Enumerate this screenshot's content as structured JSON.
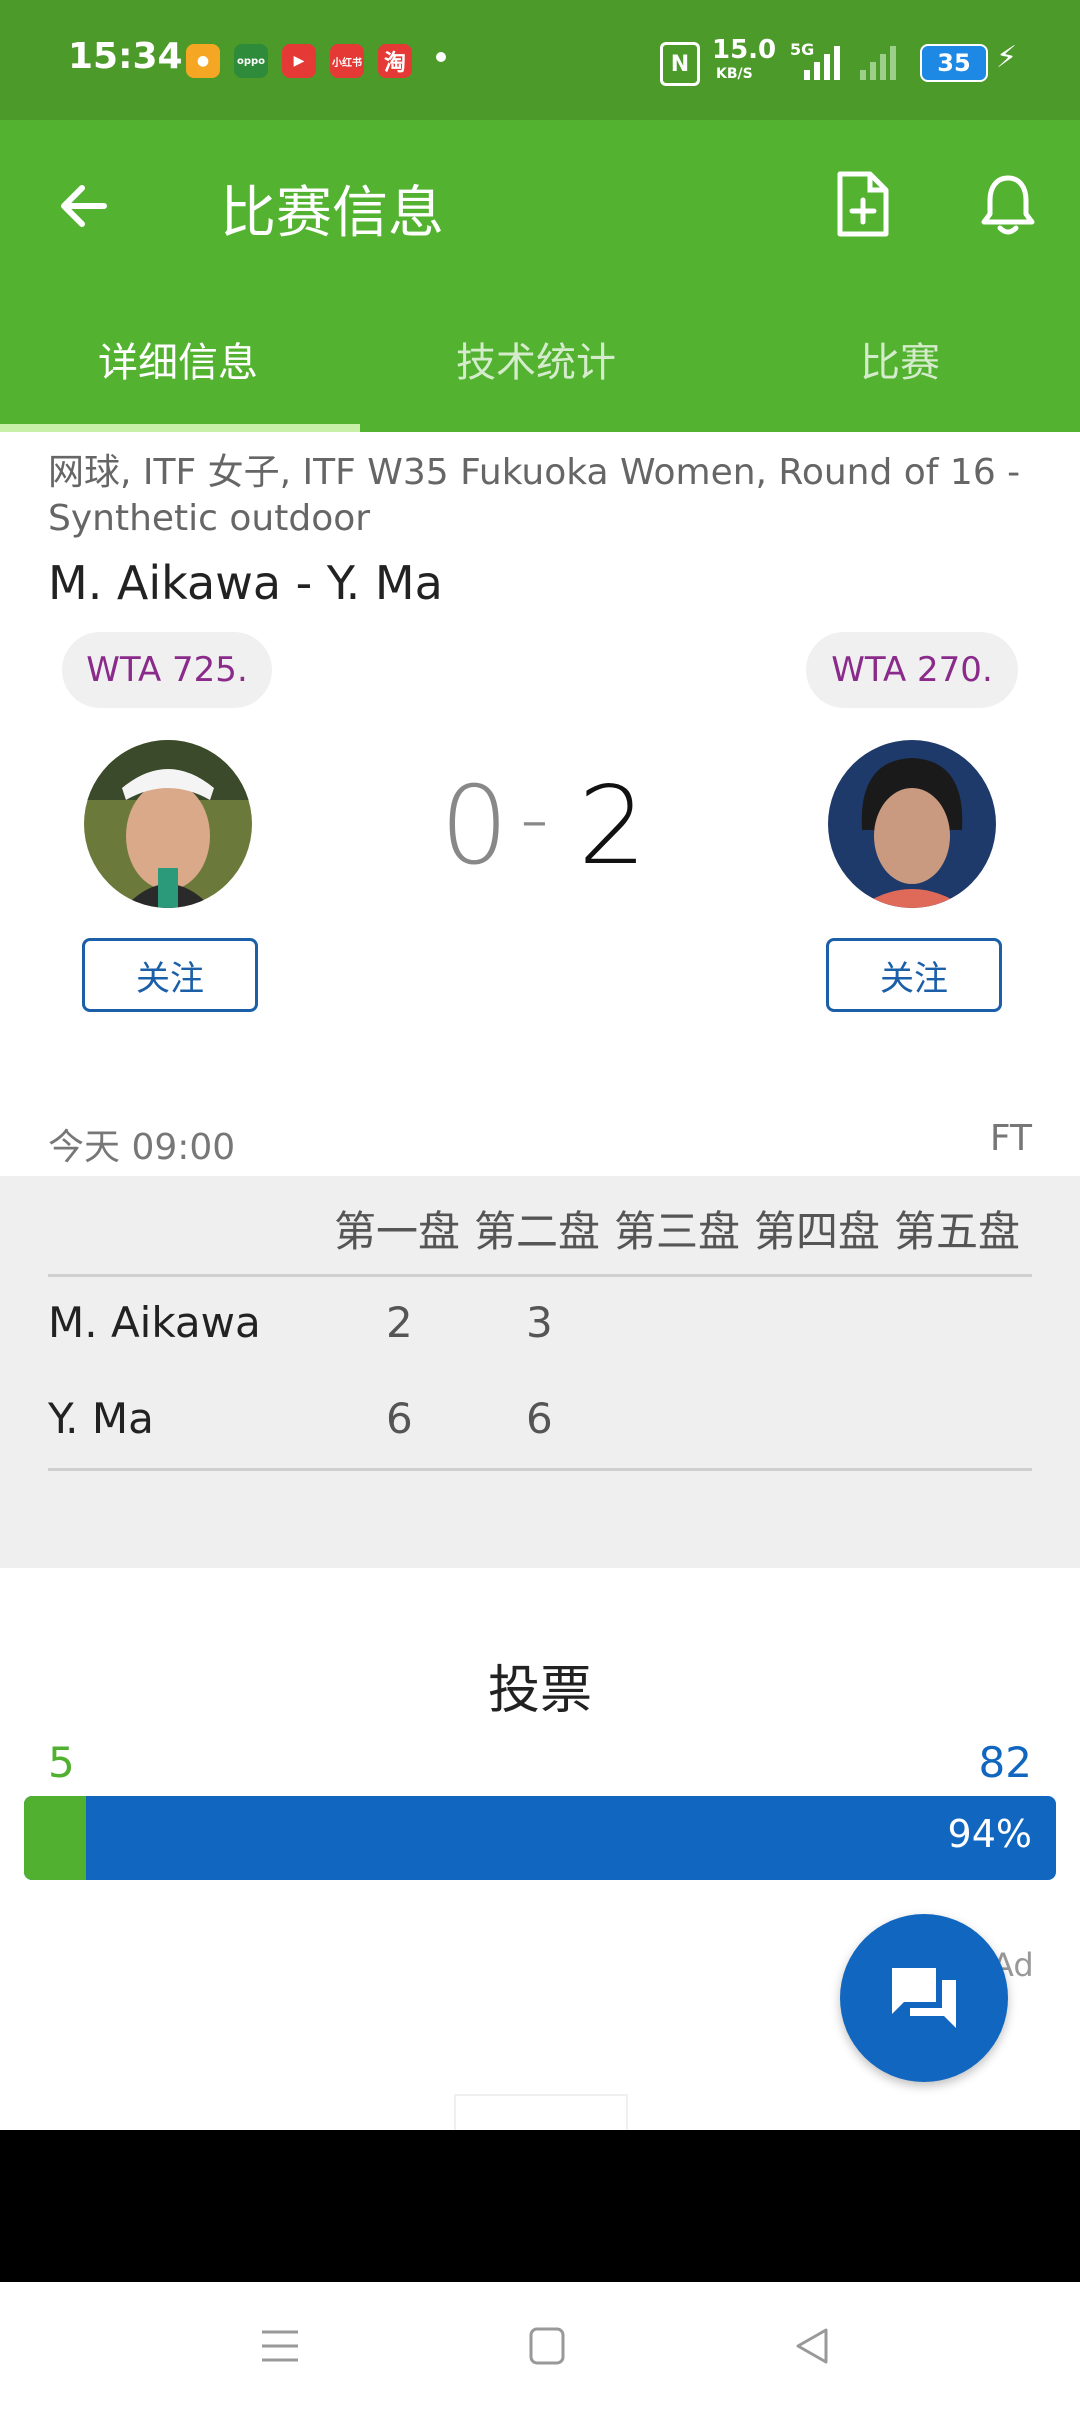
{
  "status_bar": {
    "time": "15:34",
    "net_speed_value": "15.0",
    "net_speed_unit": "KB/S",
    "network": "5G",
    "battery": "35",
    "app_icons": [
      "weibo-icon",
      "oppo-icon",
      "video-icon",
      "xiaohongshu-icon",
      "taobao-icon"
    ],
    "app_icon_labels": [
      "",
      "oppo",
      "",
      "小红书",
      "淘"
    ]
  },
  "header": {
    "title": "比赛信息"
  },
  "tabs": [
    {
      "label": "详细信息",
      "active": true
    },
    {
      "label": "技术统计",
      "active": false
    },
    {
      "label": "比赛",
      "active": false
    }
  ],
  "match": {
    "info": "网球, ITF 女子, ITF W35 Fukuoka Women, Round of 16 - Synthetic outdoor",
    "title": "M. Aikawa - Y. Ma",
    "home": {
      "rank": "WTA 725.",
      "follow": "关注"
    },
    "away": {
      "rank": "WTA 270.",
      "follow": "关注"
    },
    "score_home": "0",
    "score_sep": "-",
    "score_away": "2",
    "datetime": "今天 09:00",
    "status": "FT"
  },
  "sets": {
    "headers": [
      "第一盘",
      "第二盘",
      "第三盘",
      "第四盘",
      "第五盘"
    ],
    "rows": [
      {
        "name": "M. Aikawa",
        "scores": [
          "2",
          "3"
        ]
      },
      {
        "name": "Y. Ma",
        "scores": [
          "6",
          "6"
        ]
      }
    ]
  },
  "vote": {
    "title": "投票",
    "home_votes": "5",
    "away_votes": "82",
    "away_percent_label": "94%",
    "home_fraction": 0.06,
    "colors": {
      "home": "#52b030",
      "away": "#1167c0"
    }
  },
  "ad": {
    "label": "Ad"
  },
  "colors": {
    "appbar": "#53b230",
    "statusbar": "#4c9a2a",
    "accent": "#1167c0"
  }
}
